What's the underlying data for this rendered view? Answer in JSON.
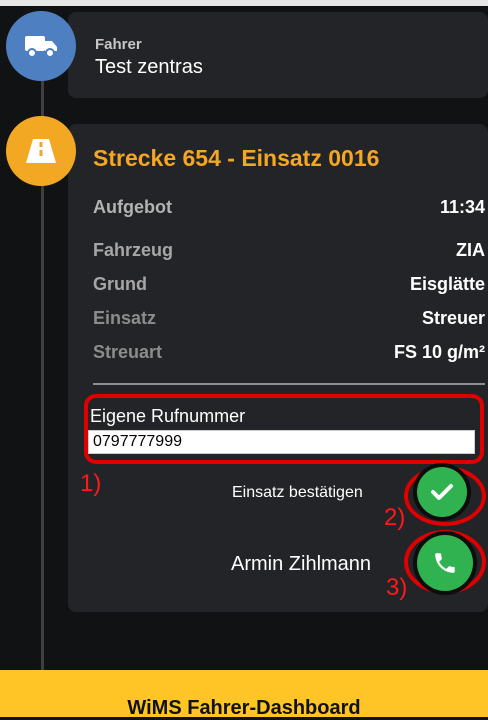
{
  "driver": {
    "label": "Fahrer",
    "name": "Test zentras"
  },
  "mission": {
    "title": "Strecke 654 - Einsatz 0016",
    "rows": [
      {
        "label": "Aufgebot",
        "value": "11:34"
      },
      {
        "label": "Fahrzeug",
        "value": "ZIA"
      },
      {
        "label": "Grund",
        "value": "Eisglätte"
      },
      {
        "label": "Einsatz",
        "value": "Streuer"
      },
      {
        "label": "Streuart",
        "value": "FS 10 g/m²"
      }
    ]
  },
  "phone": {
    "label": "Eigene Rufnummer",
    "value": "0797777999"
  },
  "actions": {
    "confirm_label": "Einsatz bestätigen",
    "call_label": "Armin Zihlmann"
  },
  "annotations": [
    "1)",
    "2)",
    "3)"
  ],
  "footer": {
    "title": "WiMS Fahrer-Dashboard"
  },
  "icons": {
    "truck": "truck-icon",
    "road": "road-icon",
    "check": "check-icon",
    "phone": "phone-icon"
  },
  "colors": {
    "accent": "#f5a623",
    "driver_badge": "#4e7fc1",
    "success": "#2fb24f",
    "highlight": "#e00000",
    "footer": "#ffc425"
  }
}
